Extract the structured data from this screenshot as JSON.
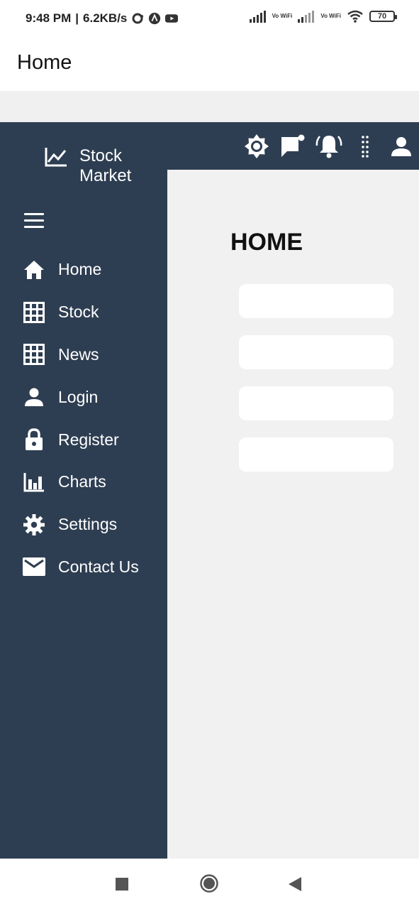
{
  "status_bar": {
    "time": "9:48 PM",
    "speed": "6.2KB/s",
    "vowifi_1": "Vo WiFi",
    "vowifi_2": "Vo WiFi",
    "battery": "70"
  },
  "app_bar": {
    "title": "Home"
  },
  "sidebar": {
    "brand_line1": "Stock",
    "brand_line2": "Market",
    "items": [
      {
        "label": "Home",
        "icon": "home-icon"
      },
      {
        "label": "Stock",
        "icon": "grid-icon"
      },
      {
        "label": "News",
        "icon": "grid-icon"
      },
      {
        "label": "Login",
        "icon": "person-icon"
      },
      {
        "label": "Register",
        "icon": "lock-icon"
      },
      {
        "label": "Charts",
        "icon": "bar-chart-icon"
      },
      {
        "label": "Settings",
        "icon": "gear-icon"
      },
      {
        "label": "Contact Us",
        "icon": "mail-icon"
      }
    ]
  },
  "topbar_icons": [
    "brightness-icon",
    "chat-notification-icon",
    "bell-icon",
    "dots-vertical-icon",
    "account-icon"
  ],
  "main": {
    "heading": "HOME",
    "card_count": 4
  },
  "colors": {
    "sidebar": "#2e3e52",
    "content_bg": "#f1f1f1",
    "card": "#ffffff"
  }
}
